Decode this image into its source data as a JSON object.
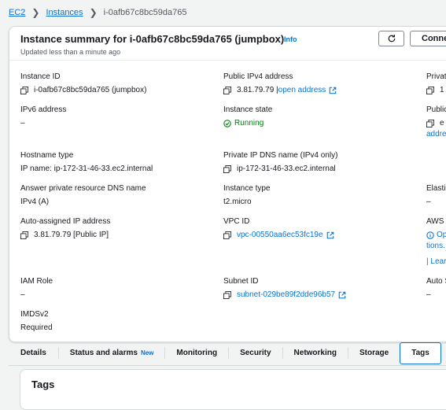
{
  "breadcrumb": {
    "root": "EC2",
    "parent": "Instances",
    "current": "i-0afb67c8bc59da765"
  },
  "header": {
    "title": "Instance summary for i-0afb67c8bc59da765 (jumpbox)",
    "info": "Info",
    "updated": "Updated less than a minute ago",
    "connect_label": "Conne"
  },
  "fields": {
    "instance_id": {
      "label": "Instance ID",
      "value": "i-0afb67c8bc59da765 (jumpbox)"
    },
    "public_ipv4": {
      "label": "Public IPv4 address",
      "value": "3.81.79.79 |",
      "link": "open address"
    },
    "ipv6": {
      "label": "IPv6 address",
      "value": "–"
    },
    "state": {
      "label": "Instance state",
      "value": "Running"
    },
    "hostname_type": {
      "label": "Hostname type",
      "value": "IP name: ip-172-31-46-33.ec2.internal"
    },
    "private_dns": {
      "label": "Private IP DNS name (IPv4 only)",
      "value": "ip-172-31-46-33.ec2.internal"
    },
    "answer_dns": {
      "label": "Answer private resource DNS name",
      "value": "IPv4 (A)"
    },
    "instance_type": {
      "label": "Instance type",
      "value": "t2.micro"
    },
    "auto_ip": {
      "label": "Auto-assigned IP address",
      "value": "3.81.79.79 [Public IP]"
    },
    "vpc": {
      "label": "VPC ID",
      "value": "vpc-00550aa6ec53fc19e"
    },
    "iam": {
      "label": "IAM Role",
      "value": "–"
    },
    "subnet": {
      "label": "Subnet ID",
      "value": "subnet-029be89f2dde96b57"
    },
    "imds": {
      "label": "IMDSv2",
      "value": "Required"
    }
  },
  "right_column": {
    "private": "Privat",
    "private_val": "1",
    "public": "Public",
    "public_val": "e",
    "addre": "addre",
    "elastic": "Elastic",
    "elastic_val": "–",
    "aws": "AWS C",
    "op": "Op",
    "tions": "tions.",
    "lear": "| Lear",
    "auto": "Auto S",
    "auto_val": "–"
  },
  "tabs": [
    {
      "label": "Details"
    },
    {
      "label": "Status and alarms",
      "badge": "New"
    },
    {
      "label": "Monitoring"
    },
    {
      "label": "Security"
    },
    {
      "label": "Networking"
    },
    {
      "label": "Storage"
    },
    {
      "label": "Tags"
    }
  ],
  "tags_section": {
    "title": "Tags"
  },
  "colors": {
    "link": "#0972d3",
    "running": "#037f0c",
    "border": "#d5dbdb"
  }
}
